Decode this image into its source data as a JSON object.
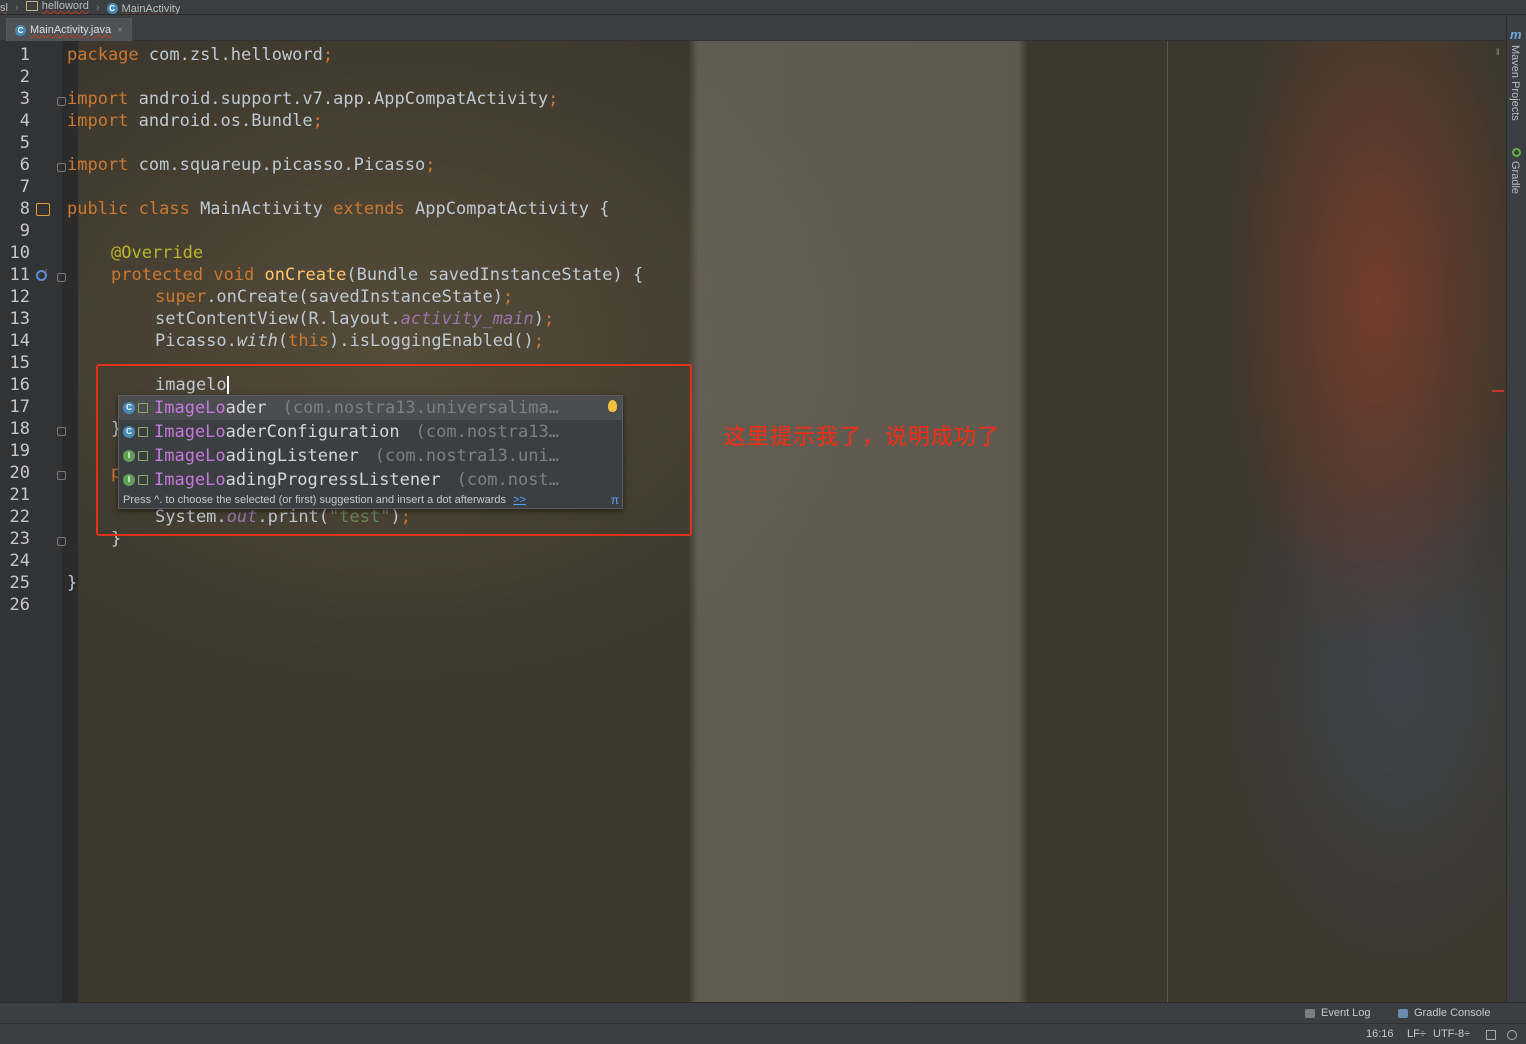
{
  "breadcrumb": {
    "items": [
      {
        "label": "sl",
        "icon": "none"
      },
      {
        "label": "helloword",
        "icon": "folder-icon"
      },
      {
        "label": "MainActivity",
        "icon": "class-icon"
      }
    ]
  },
  "tabs": [
    {
      "label": "MainActivity.java",
      "icon": "class-icon",
      "close": "×"
    }
  ],
  "gutter": {
    "line_numbers": [
      "1",
      "2",
      "3",
      "4",
      "5",
      "6",
      "7",
      "8",
      "9",
      "10",
      "11",
      "12",
      "13",
      "14",
      "15",
      "16",
      "17",
      "18",
      "19",
      "20",
      "21",
      "22",
      "23",
      "24",
      "25",
      "26"
    ]
  },
  "code": {
    "line1": {
      "kw": "package",
      "rest": " com.zsl.helloword",
      "semi": ";"
    },
    "line3": {
      "kw": "import",
      "rest": " android.support.v7.app.AppCompatActivity",
      "semi": ";"
    },
    "line4": {
      "kw": "import",
      "rest": " android.os.Bundle",
      "semi": ";"
    },
    "line6": {
      "kw": "import",
      "rest": " com.squareup.picasso.Picasso",
      "semi": ";"
    },
    "line8": {
      "kw1": "public class",
      "name": " MainActivity ",
      "kw2": "extends",
      "rest": " AppCompatActivity {"
    },
    "line10": {
      "ann": "@Override"
    },
    "line11": {
      "kw": "protected void ",
      "fn": "onCreate",
      "rest": "(Bundle savedInstanceState) {"
    },
    "line12": {
      "kw": "super",
      "rest": ".onCreate(savedInstanceState)",
      "semi": ";"
    },
    "line13": {
      "pre": "setContentView(R.layout.",
      "it": "activity_main",
      "post": ")",
      "semi": ";"
    },
    "line14": {
      "pre": "Picasso.",
      "it": "with",
      "mid1": "(",
      "kw": "this",
      "post": ").isLoggingEnabled()",
      "semi": ";"
    },
    "line16": {
      "typed": "imagelo"
    },
    "line18": {
      "text": "}"
    },
    "line20": {
      "text": "p"
    },
    "line22": {
      "pre": "System.",
      "it": "out",
      "mid": ".print(",
      "str": "\"test\"",
      "post": ")",
      "semi": ";"
    },
    "line23": {
      "text": "}"
    },
    "line25": {
      "text": "}"
    }
  },
  "completion": {
    "items": [
      {
        "icon": "C",
        "match": "ImageLo",
        "rest": "ader",
        "pkg": "(com.nostra13.universalima…",
        "selected": true
      },
      {
        "icon": "C",
        "match": "ImageLo",
        "rest": "aderConfiguration",
        "pkg": "(com.nostra13…",
        "selected": false
      },
      {
        "icon": "I",
        "match": "ImageLo",
        "rest": "adingListener",
        "pkg": "(com.nostra13.uni…",
        "selected": false
      },
      {
        "icon": "I",
        "match": "ImageLo",
        "rest": "adingProgressListener",
        "pkg": "(com.nost…",
        "selected": false
      }
    ],
    "hint": "Press ^. to choose the selected (or first) suggestion and insert a dot afterwards",
    "hint_link": ">>",
    "pi": "π"
  },
  "annotation": {
    "note": "这里提示我了，说明成功了",
    "box_color": "#e0301e"
  },
  "right_strip": {
    "maven_icon": "m",
    "maven_label": "Maven Projects",
    "gradle_label": "Gradle"
  },
  "bottom_tools": {
    "event_log": "Event Log",
    "gradle_console": "Gradle Console"
  },
  "status": {
    "position": "16:16",
    "line_sep": "LF÷",
    "encoding": "UTF-8÷"
  },
  "colors": {
    "keyword": "#cc7832",
    "annotation": "#bbb529",
    "method": "#ffc66d",
    "field_italic": "#9876aa",
    "string": "#6a8759",
    "match_highlight": "#c678dd"
  }
}
